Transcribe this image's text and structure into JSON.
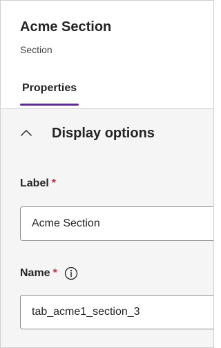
{
  "header": {
    "title": "Acme Section",
    "subtitle": "Section"
  },
  "tabs": [
    {
      "label": "Properties",
      "selected": true
    }
  ],
  "display_options": {
    "title": "Display options",
    "expanded": true,
    "chevron_icon": "chevron-up-icon"
  },
  "fields": {
    "label": {
      "label": "Label",
      "required_marker": "*",
      "value": "Acme Section"
    },
    "name": {
      "label": "Name",
      "required_marker": "*",
      "info_icon": "info-icon",
      "value": "tab_acme1_section_3"
    }
  },
  "colors": {
    "tab_accent": "#5c2e91",
    "required": "#c4314b",
    "content_background": "#f5f5f5"
  }
}
